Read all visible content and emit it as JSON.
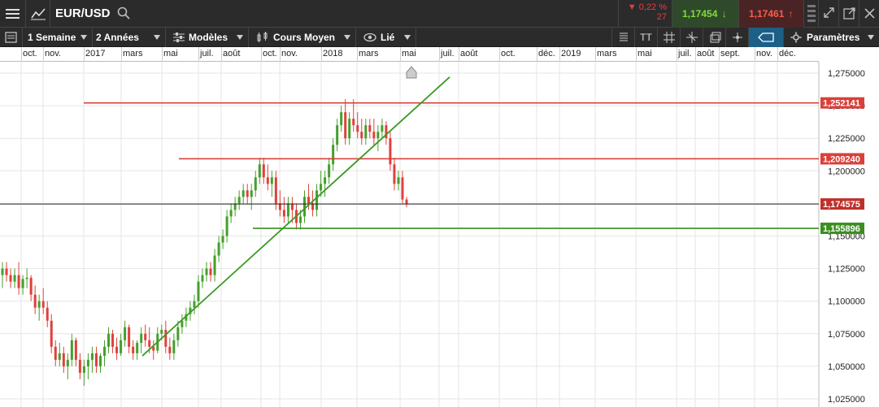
{
  "header": {
    "symbol": "EUR/USD",
    "change_pct": "▼ 0,22 %",
    "change_pts": "27",
    "bid": "1,17454",
    "ask": "1,17461",
    "bid_arrow": "↓",
    "ask_arrow": "↑"
  },
  "toolbar": {
    "period": "1 Semaine",
    "range": "2 Années",
    "models": "Modèles",
    "price_type": "Cours Moyen",
    "link": "Lié",
    "params": "Paramètres",
    "text_tool": "TT"
  },
  "time_axis": {
    "labels": [
      {
        "text": "oct."
      },
      {
        "text": "nov."
      },
      {
        "text": "2017"
      },
      {
        "text": "mars"
      },
      {
        "text": "mai"
      },
      {
        "text": "juil."
      },
      {
        "text": "août"
      },
      {
        "text": "oct."
      },
      {
        "text": "nov."
      },
      {
        "text": "2018"
      },
      {
        "text": "mars"
      },
      {
        "text": "mai"
      },
      {
        "text": "juil."
      },
      {
        "text": "août"
      },
      {
        "text": "oct."
      },
      {
        "text": "déc."
      },
      {
        "text": "2019"
      },
      {
        "text": "mars"
      },
      {
        "text": "mai"
      },
      {
        "text": "juil."
      },
      {
        "text": "août"
      },
      {
        "text": "sept."
      },
      {
        "text": "nov."
      },
      {
        "text": "déc."
      }
    ]
  },
  "price_axis": {
    "labels": [
      "1,275000",
      "1,250000",
      "1,225000",
      "1,200000",
      "1,150000",
      "1,125000",
      "1,100000",
      "1,075000",
      "1,050000",
      "1,025000"
    ]
  },
  "levels": {
    "red_high": "1,252141",
    "red_mid": "1,209240",
    "current": "1,174575",
    "green_low": "1,155896"
  },
  "colors": {
    "up": "#43a02b",
    "down": "#e0403c",
    "resistance": "#d9403a",
    "support": "#3a8f1f",
    "trend": "#3a9a22",
    "current_tag": "#c0302b"
  },
  "chart_data": {
    "type": "candlestick",
    "ylim": [
      1.025,
      1.275
    ],
    "candles": [
      [
        1.12,
        1.13,
        1.11,
        1.125
      ],
      [
        1.125,
        1.13,
        1.115,
        1.12
      ],
      [
        1.12,
        1.125,
        1.11,
        1.115
      ],
      [
        1.115,
        1.125,
        1.11,
        1.12
      ],
      [
        1.12,
        1.13,
        1.105,
        1.11
      ],
      [
        1.11,
        1.12,
        1.105,
        1.117
      ],
      [
        1.117,
        1.125,
        1.11,
        1.118
      ],
      [
        1.118,
        1.12,
        1.1,
        1.105
      ],
      [
        1.105,
        1.112,
        1.09,
        1.095
      ],
      [
        1.095,
        1.105,
        1.085,
        1.1
      ],
      [
        1.1,
        1.11,
        1.09,
        1.095
      ],
      [
        1.095,
        1.1,
        1.08,
        1.085
      ],
      [
        1.085,
        1.09,
        1.06,
        1.065
      ],
      [
        1.065,
        1.07,
        1.05,
        1.055
      ],
      [
        1.055,
        1.068,
        1.05,
        1.06
      ],
      [
        1.06,
        1.065,
        1.045,
        1.05
      ],
      [
        1.05,
        1.06,
        1.04,
        1.055
      ],
      [
        1.055,
        1.075,
        1.05,
        1.07
      ],
      [
        1.07,
        1.072,
        1.05,
        1.055
      ],
      [
        1.055,
        1.06,
        1.04,
        1.045
      ],
      [
        1.045,
        1.055,
        1.035,
        1.05
      ],
      [
        1.05,
        1.06,
        1.04,
        1.055
      ],
      [
        1.055,
        1.065,
        1.045,
        1.06
      ],
      [
        1.06,
        1.065,
        1.045,
        1.05
      ],
      [
        1.05,
        1.06,
        1.045,
        1.058
      ],
      [
        1.058,
        1.07,
        1.05,
        1.065
      ],
      [
        1.065,
        1.08,
        1.06,
        1.075
      ],
      [
        1.075,
        1.078,
        1.06,
        1.065
      ],
      [
        1.065,
        1.072,
        1.055,
        1.06
      ],
      [
        1.06,
        1.075,
        1.058,
        1.07
      ],
      [
        1.07,
        1.085,
        1.065,
        1.08
      ],
      [
        1.08,
        1.082,
        1.06,
        1.065
      ],
      [
        1.065,
        1.07,
        1.055,
        1.06
      ],
      [
        1.06,
        1.07,
        1.055,
        1.068
      ],
      [
        1.068,
        1.08,
        1.06,
        1.075
      ],
      [
        1.075,
        1.082,
        1.065,
        1.07
      ],
      [
        1.07,
        1.08,
        1.06,
        1.065
      ],
      [
        1.065,
        1.07,
        1.055,
        1.062
      ],
      [
        1.062,
        1.08,
        1.06,
        1.075
      ],
      [
        1.075,
        1.082,
        1.07,
        1.078
      ],
      [
        1.078,
        1.085,
        1.06,
        1.065
      ],
      [
        1.065,
        1.072,
        1.055,
        1.06
      ],
      [
        1.06,
        1.075,
        1.055,
        1.07
      ],
      [
        1.07,
        1.085,
        1.065,
        1.08
      ],
      [
        1.08,
        1.09,
        1.075,
        1.085
      ],
      [
        1.085,
        1.095,
        1.08,
        1.09
      ],
      [
        1.09,
        1.1,
        1.085,
        1.095
      ],
      [
        1.095,
        1.105,
        1.09,
        1.1
      ],
      [
        1.1,
        1.12,
        1.095,
        1.115
      ],
      [
        1.115,
        1.125,
        1.11,
        1.12
      ],
      [
        1.12,
        1.13,
        1.115,
        1.125
      ],
      [
        1.125,
        1.13,
        1.115,
        1.12
      ],
      [
        1.12,
        1.14,
        1.115,
        1.135
      ],
      [
        1.135,
        1.15,
        1.13,
        1.145
      ],
      [
        1.145,
        1.155,
        1.14,
        1.15
      ],
      [
        1.15,
        1.17,
        1.145,
        1.165
      ],
      [
        1.165,
        1.175,
        1.16,
        1.17
      ],
      [
        1.17,
        1.18,
        1.165,
        1.175
      ],
      [
        1.175,
        1.185,
        1.17,
        1.18
      ],
      [
        1.18,
        1.19,
        1.175,
        1.185
      ],
      [
        1.185,
        1.19,
        1.175,
        1.18
      ],
      [
        1.18,
        1.19,
        1.17,
        1.185
      ],
      [
        1.185,
        1.2,
        1.18,
        1.195
      ],
      [
        1.195,
        1.21,
        1.19,
        1.205
      ],
      [
        1.205,
        1.21,
        1.19,
        1.195
      ],
      [
        1.195,
        1.205,
        1.185,
        1.19
      ],
      [
        1.19,
        1.2,
        1.18,
        1.195
      ],
      [
        1.195,
        1.2,
        1.17,
        1.175
      ],
      [
        1.175,
        1.185,
        1.165,
        1.17
      ],
      [
        1.17,
        1.18,
        1.16,
        1.165
      ],
      [
        1.165,
        1.18,
        1.16,
        1.175
      ],
      [
        1.175,
        1.18,
        1.16,
        1.17
      ],
      [
        1.17,
        1.175,
        1.155,
        1.16
      ],
      [
        1.16,
        1.17,
        1.155,
        1.165
      ],
      [
        1.165,
        1.185,
        1.16,
        1.18
      ],
      [
        1.18,
        1.19,
        1.17,
        1.175
      ],
      [
        1.175,
        1.185,
        1.165,
        1.17
      ],
      [
        1.17,
        1.19,
        1.165,
        1.185
      ],
      [
        1.185,
        1.2,
        1.18,
        1.19
      ],
      [
        1.19,
        1.2,
        1.18,
        1.195
      ],
      [
        1.195,
        1.21,
        1.19,
        1.205
      ],
      [
        1.205,
        1.225,
        1.2,
        1.22
      ],
      [
        1.22,
        1.24,
        1.215,
        1.235
      ],
      [
        1.235,
        1.25,
        1.23,
        1.245
      ],
      [
        1.245,
        1.255,
        1.22,
        1.225
      ],
      [
        1.225,
        1.245,
        1.22,
        1.24
      ],
      [
        1.24,
        1.255,
        1.23,
        1.235
      ],
      [
        1.235,
        1.245,
        1.225,
        1.23
      ],
      [
        1.23,
        1.24,
        1.22,
        1.225
      ],
      [
        1.225,
        1.24,
        1.22,
        1.235
      ],
      [
        1.235,
        1.24,
        1.225,
        1.23
      ],
      [
        1.23,
        1.24,
        1.22,
        1.225
      ],
      [
        1.225,
        1.235,
        1.215,
        1.23
      ],
      [
        1.23,
        1.24,
        1.225,
        1.235
      ],
      [
        1.235,
        1.238,
        1.22,
        1.225
      ],
      [
        1.225,
        1.23,
        1.2,
        1.205
      ],
      [
        1.205,
        1.21,
        1.185,
        1.19
      ],
      [
        1.19,
        1.2,
        1.185,
        1.195
      ],
      [
        1.195,
        1.2,
        1.175,
        1.178
      ],
      [
        1.178,
        1.18,
        1.172,
        1.1746
      ]
    ]
  }
}
